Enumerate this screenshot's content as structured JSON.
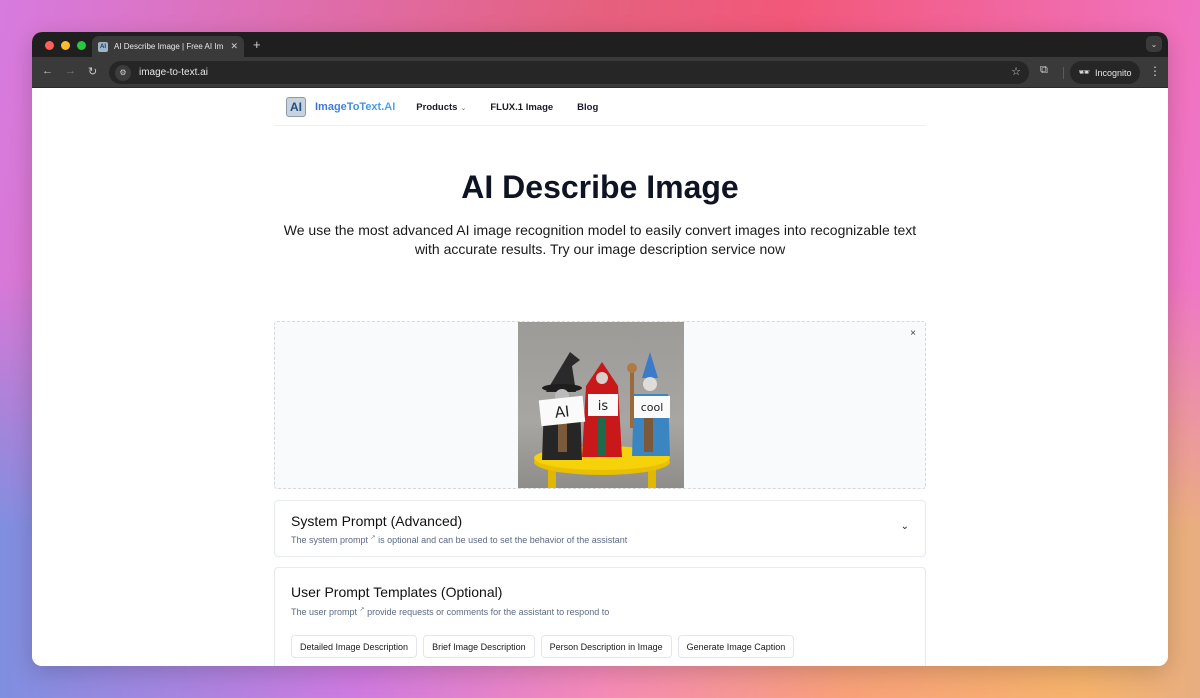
{
  "browser": {
    "tab": {
      "title": "AI Describe Image | Free AI Im",
      "favicon": "AI"
    },
    "new_tab_label": "+",
    "url": "image-to-text.ai",
    "incognito_label": "Incognito"
  },
  "site_nav": {
    "logo_text": "AI",
    "brand": "ImageToText.AI",
    "links": [
      {
        "label": "Products",
        "has_dropdown": true
      },
      {
        "label": "FLUX.1 Image"
      },
      {
        "label": "Blog"
      }
    ]
  },
  "hero": {
    "title": "AI Describe Image",
    "subtitle": "We use the most advanced AI image recognition model to easily convert images into recognizable text with accurate results. Try our image description service now"
  },
  "upload": {
    "preview_alt": "Three wizard figurines on a yellow stool holding signs",
    "sign_texts": [
      "AI",
      "is",
      "cool"
    ],
    "remove_label": "×"
  },
  "system_prompt": {
    "title": "System Prompt (Advanced)",
    "desc_before": "The system prompt",
    "desc_after": "is optional and can be used to set the behavior of the assistant",
    "link_mark": "↗"
  },
  "user_prompt": {
    "title": "User Prompt Templates (Optional)",
    "desc_before": "The user prompt",
    "desc_after": "provide requests or comments for the assistant to respond to",
    "link_mark": "↗",
    "templates": [
      "Detailed Image Description",
      "Brief Image Description",
      "Person Description in Image",
      "Generate Image Caption"
    ]
  }
}
